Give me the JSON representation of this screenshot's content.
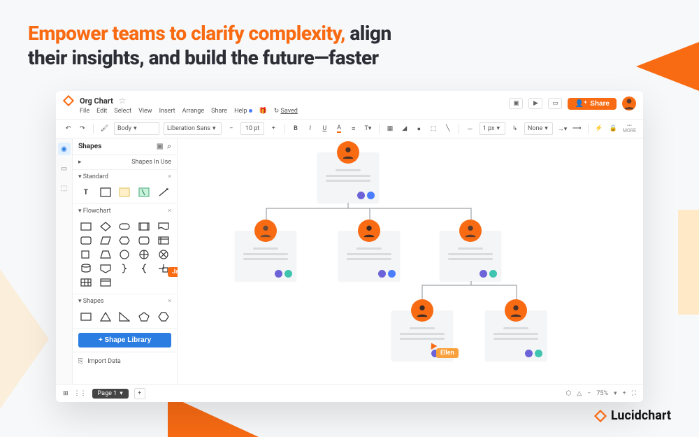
{
  "headline": {
    "orange": "Empower teams to clarify complexity,",
    "rest1": " align",
    "rest2": "their insights, and build the future—faster"
  },
  "brand": "Lucidchart",
  "doc": {
    "title": "Org Chart"
  },
  "menu": {
    "file": "File",
    "edit": "Edit",
    "select": "Select",
    "view": "View",
    "insert": "Insert",
    "arrange": "Arrange",
    "share": "Share",
    "help": "Help",
    "saved": "Saved"
  },
  "titlebar_actions": {
    "share": "Share"
  },
  "toolbar": {
    "style": "Body",
    "font": "Liberation Sans",
    "size": "10 pt",
    "stroke": "1 px",
    "line_end": "None",
    "more": "MORE"
  },
  "sidebar": {
    "title": "Shapes",
    "in_use": "Shapes In Use",
    "standard": "Standard",
    "flowchart": "Flowchart",
    "shapes": "Shapes",
    "shape_library": "+  Shape Library",
    "import": "Import Data"
  },
  "cursors": {
    "jared": "Jared",
    "ellen": "Ellen"
  },
  "status": {
    "page": "Page 1",
    "zoom": "75%"
  }
}
